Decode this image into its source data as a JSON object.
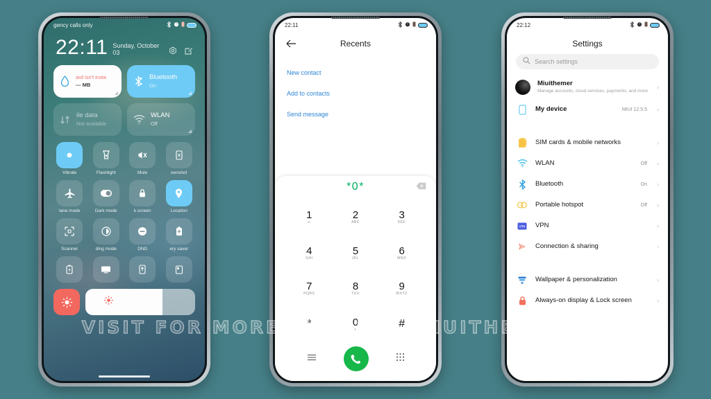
{
  "watermark": "VISIT FOR MORE THEMES - MIUITHEMER.COM",
  "colors": {
    "background": "#467f87",
    "accent_blue": "#6ecbf5",
    "accent_green": "#17b74a",
    "dial_green": "#00b060",
    "link_blue": "#2f86d4",
    "brightness_red": "#f2685f"
  },
  "phone1": {
    "status": {
      "carrier": "gency calls only",
      "icons": [
        "bluetooth-icon",
        "alarm-icon",
        "sim-icon"
      ],
      "battery": "battery-icon"
    },
    "clock": {
      "time": "22:11",
      "date": "Sunday, October 03",
      "action_icons": [
        "settings-gear-icon",
        "edit-icon"
      ]
    },
    "big_tiles": [
      {
        "title": "ard isn't insta",
        "sub": "--- MB",
        "icon": "data-drop-icon",
        "state": "white"
      },
      {
        "title": "Bluetooth",
        "sub": "On",
        "icon": "bluetooth-icon",
        "state": "on"
      },
      {
        "title": "ile data",
        "sub": "Not available",
        "icon": "mobile-data-icon",
        "state": "off"
      },
      {
        "title": "WLAN",
        "sub": "Off",
        "icon": "wifi-icon",
        "state": "off"
      }
    ],
    "toggles": [
      {
        "label": "Vibrate",
        "icon": "vibrate-icon",
        "on": true
      },
      {
        "label": "Flashlight",
        "icon": "flashlight-icon",
        "on": false
      },
      {
        "label": "Mute",
        "icon": "mute-icon",
        "on": false
      },
      {
        "label": "eenshot",
        "icon": "screenshot-icon",
        "on": false
      },
      {
        "label": "lane mode",
        "icon": "airplane-icon",
        "on": false
      },
      {
        "label": "Dark mode",
        "icon": "dark-mode-icon",
        "on": false
      },
      {
        "label": "k screen",
        "icon": "lock-screen-icon",
        "on": false
      },
      {
        "label": "Location",
        "icon": "location-icon",
        "on": true
      },
      {
        "label": "Scanner",
        "icon": "scanner-icon",
        "on": false
      },
      {
        "label": "ding mode",
        "icon": "reading-mode-icon",
        "on": false
      },
      {
        "label": "DND",
        "icon": "dnd-icon",
        "on": false
      },
      {
        "label": "ery saver",
        "icon": "battery-saver-icon",
        "on": false
      }
    ],
    "toggles_row4": [
      {
        "icon": "power-saving-icon"
      },
      {
        "icon": "cast-screen-icon"
      },
      {
        "icon": "nfc-icon"
      },
      {
        "icon": "second-space-icon"
      }
    ],
    "brightness": {
      "icon": "brightness-icon",
      "level": 70
    }
  },
  "phone2": {
    "status": {
      "time": "22:11",
      "icons": [
        "bluetooth-icon",
        "alarm-icon",
        "sim-icon"
      ],
      "battery": "battery-icon"
    },
    "header": {
      "back_icon": "arrow-left-icon",
      "title": "Recents"
    },
    "links": [
      "New contact",
      "Add to contacts",
      "Send message"
    ],
    "dialpad": {
      "number": "*0*",
      "delete_icon": "backspace-icon",
      "keys": [
        {
          "digit": "1",
          "letters": "∞"
        },
        {
          "digit": "2",
          "letters": "ABC"
        },
        {
          "digit": "3",
          "letters": "DEF"
        },
        {
          "digit": "4",
          "letters": "GHI"
        },
        {
          "digit": "5",
          "letters": "JKL"
        },
        {
          "digit": "6",
          "letters": "MNO"
        },
        {
          "digit": "7",
          "letters": "PQRS"
        },
        {
          "digit": "8",
          "letters": "TUV"
        },
        {
          "digit": "9",
          "letters": "WXYZ"
        },
        {
          "digit": "*",
          "letters": ""
        },
        {
          "digit": "0",
          "letters": "+"
        },
        {
          "digit": "#",
          "letters": ""
        }
      ],
      "actions": {
        "menu_icon": "menu-lines-icon",
        "call_icon": "phone-call-icon",
        "keypad_icon": "keypad-dots-icon"
      }
    }
  },
  "phone3": {
    "status": {
      "time": "22:12",
      "icons": [
        "bluetooth-icon",
        "alarm-icon",
        "sim-icon"
      ],
      "battery": "battery-icon"
    },
    "title": "Settings",
    "search": {
      "placeholder": "Search settings",
      "icon": "search-icon"
    },
    "account": {
      "name": "Miuithemer",
      "desc": "Manage accounts, cloud services, payments, and more",
      "avatar": "avatar"
    },
    "device": {
      "name": "My device",
      "value": "MIUI 12.5.5",
      "icon": "device-icon"
    },
    "items": [
      {
        "name": "SIM cards & mobile networks",
        "value": "",
        "icon": "sim-cards-icon"
      },
      {
        "name": "WLAN",
        "value": "Off",
        "icon": "wifi-icon"
      },
      {
        "name": "Bluetooth",
        "value": "On",
        "icon": "bluetooth-icon"
      },
      {
        "name": "Portable hotspot",
        "value": "Off",
        "icon": "hotspot-icon"
      },
      {
        "name": "VPN",
        "value": "",
        "icon": "vpn-icon"
      },
      {
        "name": "Connection & sharing",
        "value": "",
        "icon": "connection-sharing-icon"
      }
    ],
    "items2": [
      {
        "name": "Wallpaper & personalization",
        "value": "",
        "icon": "wallpaper-icon"
      },
      {
        "name": "Always-on display & Lock screen",
        "value": "",
        "icon": "lock-icon"
      }
    ]
  }
}
